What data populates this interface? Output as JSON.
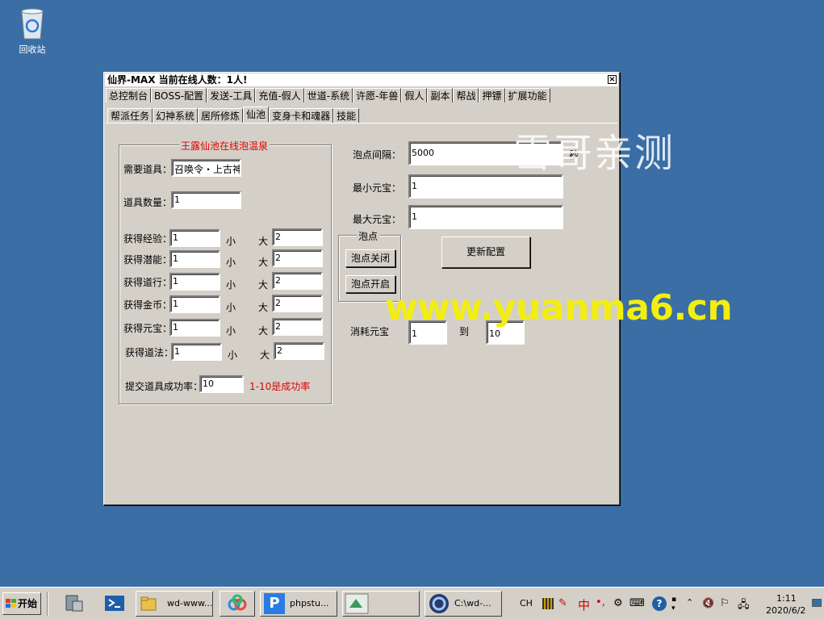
{
  "desktop": {
    "recycle_bin_label": "回收站"
  },
  "window": {
    "title": "仙界-MAX   当前在线人数：1人!",
    "close_glyph": "×",
    "tabs_row1": [
      "总控制台",
      "BOSS-配置",
      "发送-工具",
      "充值-假人",
      "世道-系统",
      "许愿-年兽",
      "假人",
      "副本",
      "帮战",
      "押镖",
      "扩展功能"
    ],
    "tabs_row2": [
      "帮派任务",
      "幻神系统",
      "居所修炼",
      "仙池",
      "变身卡和魂器",
      "技能"
    ],
    "selected_tab_row2": "仙池"
  },
  "left_group": {
    "title": "王露仙池在线泡温泉",
    "item_label": "需要道具：",
    "item_value": "召唤令・上古神",
    "quantity_label": "道具数量：",
    "quantity_value": "1",
    "small_label": "小",
    "big_label": "大",
    "rows": [
      {
        "label": "获得经验：",
        "min": "1",
        "max": "2"
      },
      {
        "label": "获得潜能：",
        "min": "1",
        "max": "2"
      },
      {
        "label": "获得道行：",
        "min": "1",
        "max": "2"
      },
      {
        "label": "获得金币：",
        "min": "1",
        "max": "2"
      },
      {
        "label": "获得元宝：",
        "min": "1",
        "max": "2"
      },
      {
        "label": "获得道法：",
        "min": "1",
        "max": "2"
      }
    ],
    "success_label": "提交道具成功率：",
    "success_value": "10",
    "success_hint": "1-10是成功率"
  },
  "right": {
    "interval_label": "泡点间隔：",
    "interval_value": "5000",
    "interval_unit": "秒",
    "min_yb_label": "最小元宝：",
    "min_yb_value": "1",
    "max_yb_label": "最大元宝：",
    "max_yb_value": "1",
    "paodian_group_title": "泡点",
    "btn_close": "泡点关闭",
    "btn_open": "泡点开启",
    "btn_update": "更新配置",
    "consume_label": "消耗元宝",
    "consume_from": "1",
    "consume_to_label": "到",
    "consume_to": "10"
  },
  "watermarks": {
    "w1": "雪哥亲测",
    "w2": "www.yuanma6.cn"
  },
  "taskbar": {
    "start_label": "开始",
    "tasks": [
      "wd-www...",
      "phpstu...",
      "C:\\wd-..."
    ],
    "lang": "CH",
    "ime_text": "中",
    "time": "1:11",
    "date": "2020/6/2"
  }
}
